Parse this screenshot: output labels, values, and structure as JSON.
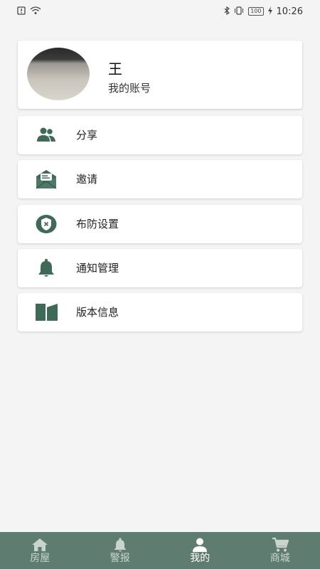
{
  "status_bar": {
    "time": "10:26",
    "battery": "100"
  },
  "profile": {
    "name": "王",
    "account_label": "我的账号"
  },
  "menu": [
    {
      "label": "分享",
      "icon": "people-icon"
    },
    {
      "label": "邀请",
      "icon": "envelope-icon"
    },
    {
      "label": "布防设置",
      "icon": "shield-icon"
    },
    {
      "label": "通知管理",
      "icon": "bell-icon"
    },
    {
      "label": "版本信息",
      "icon": "book-icon"
    }
  ],
  "tabs": [
    {
      "label": "房屋",
      "icon": "home-icon",
      "active": false
    },
    {
      "label": "警报",
      "icon": "bell-icon",
      "active": false
    },
    {
      "label": "我的",
      "icon": "person-icon",
      "active": true
    },
    {
      "label": "商城",
      "icon": "cart-icon",
      "active": false
    }
  ],
  "colors": {
    "accent": "#3f6a58",
    "tabbar": "#5e7d70"
  }
}
